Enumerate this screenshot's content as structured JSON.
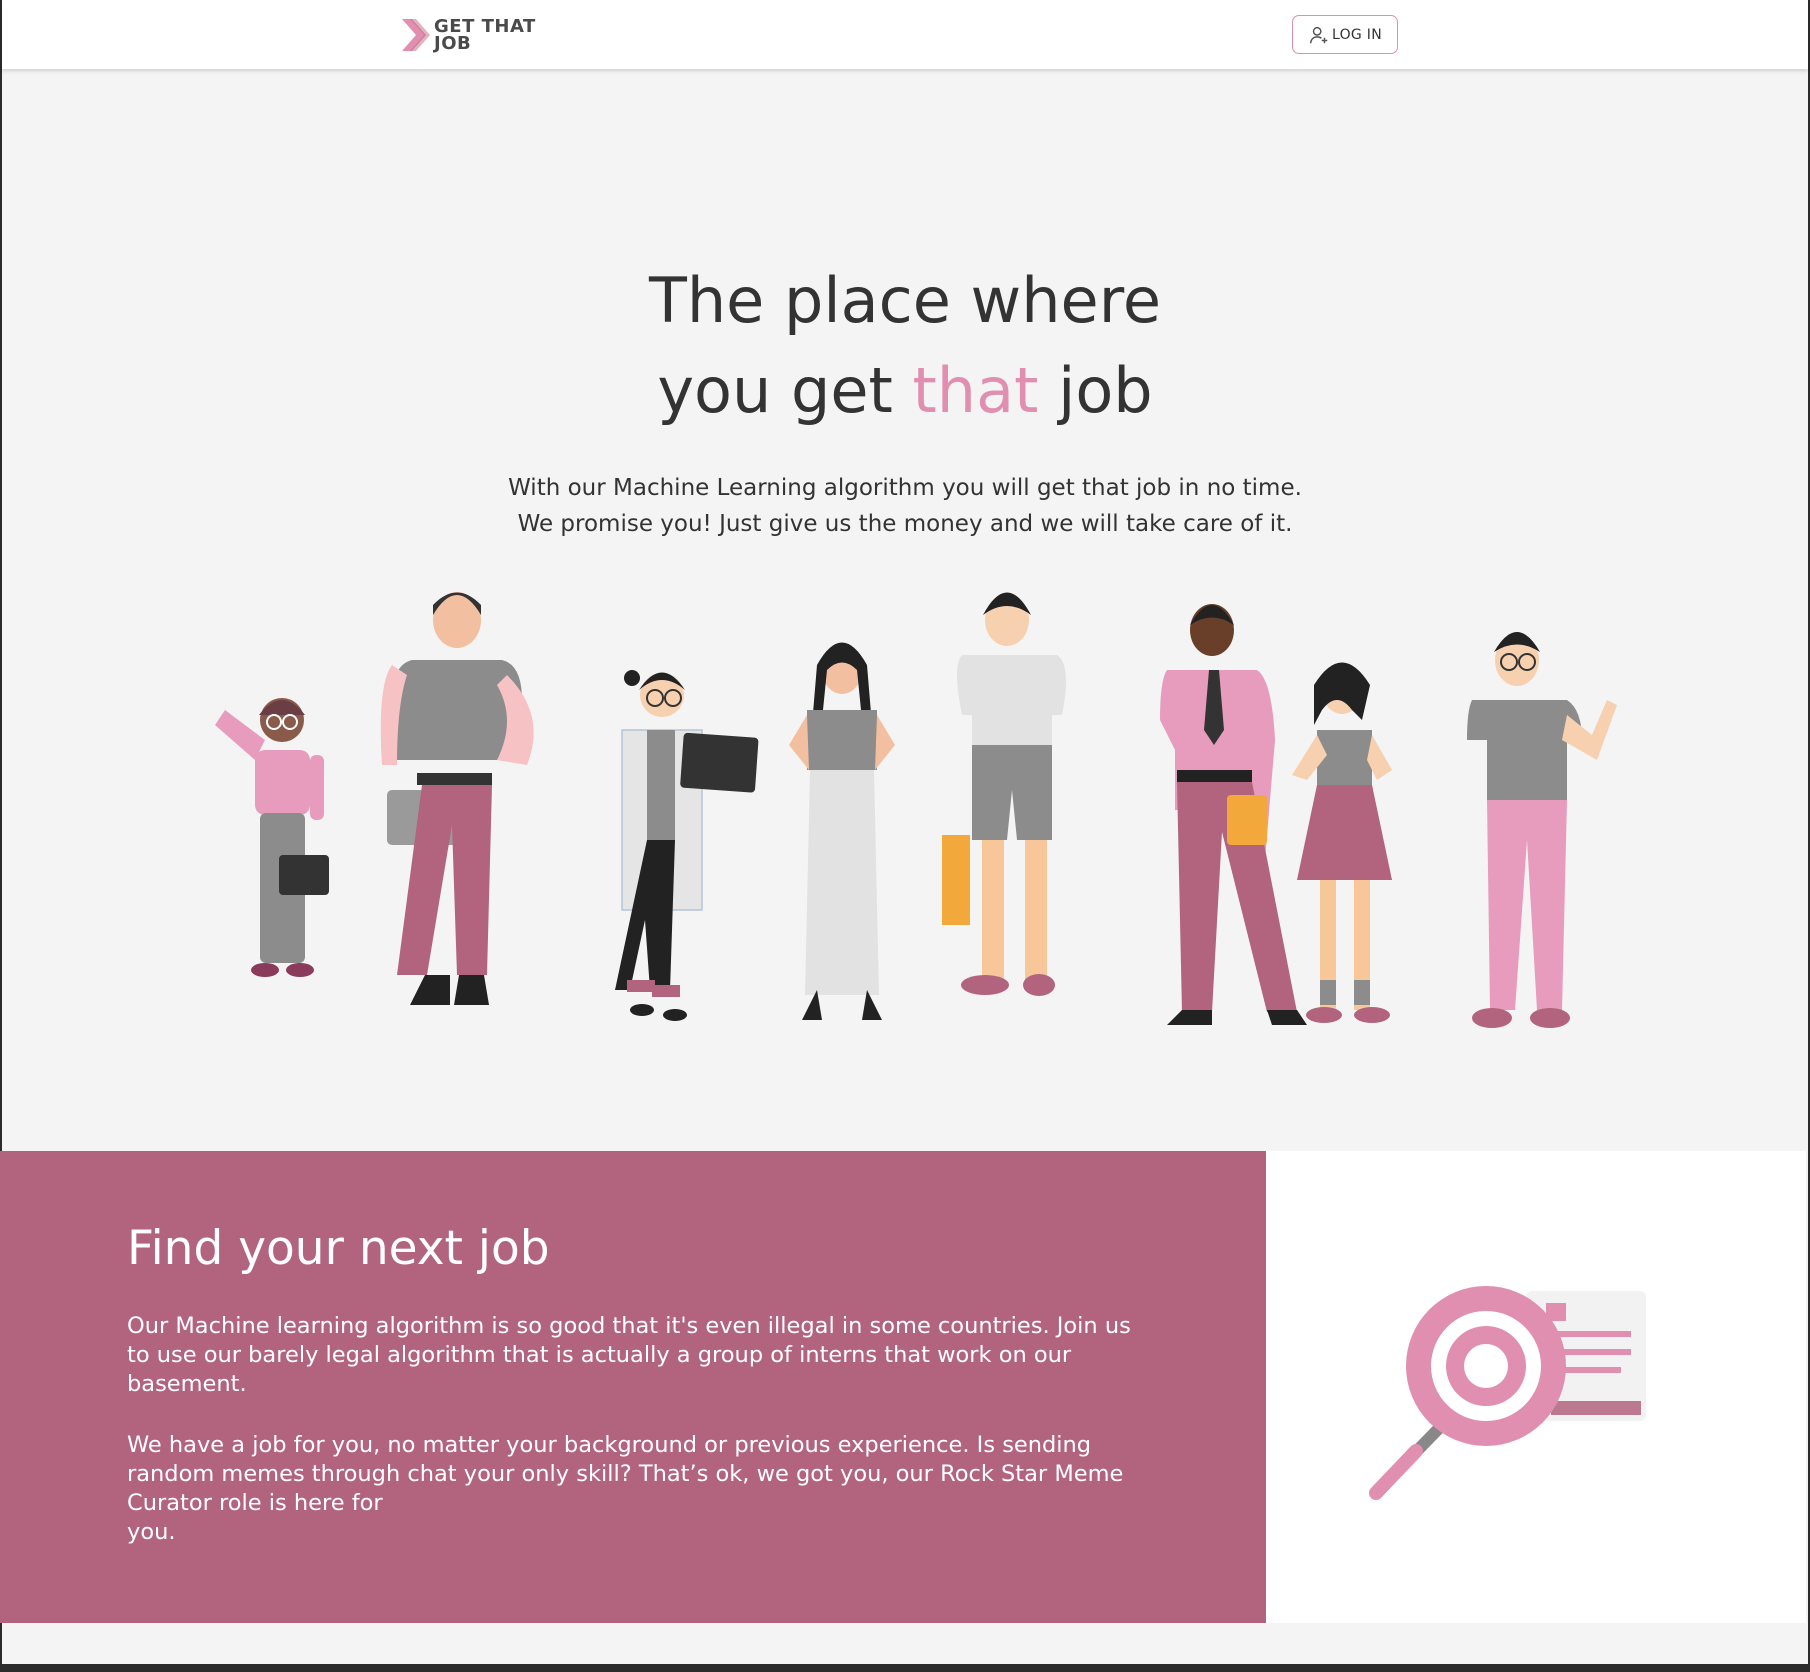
{
  "header": {
    "logo_line1": "GET THAT",
    "logo_line2": "JOB",
    "login_label": "LOG IN"
  },
  "hero": {
    "title_line1": "The place where",
    "title_line2_pre": "you get ",
    "title_line2_accent": "that",
    "title_line2_post": " job",
    "subtitle_line1": "With our Machine Learning algorithm you will get that job in no time.",
    "subtitle_line2": "We promise you! Just give us the money and we will take care of it."
  },
  "find": {
    "title": "Find your next job",
    "paragraph1": "Our Machine learning algorithm is so good that it's even illegal in some countries. Join us to use our barely legal algorithm that is actually a group of interns that work on our basement.",
    "paragraph2_line1": "We have a job for you, no matter your background or previous experience. Is sending random memes through chat your only skill? That’s ok, we got you, our Rock Star Meme Curator role is here for",
    "paragraph2_line2": "you."
  },
  "colors": {
    "accent_pink": "#e08fb0",
    "section_mauve": "#b2647f",
    "text_dark": "#333333",
    "page_bg": "#f4f4f4"
  },
  "icons": [
    "logo-chevron-icon",
    "user-plus-icon",
    "magnifier-target-icon"
  ]
}
